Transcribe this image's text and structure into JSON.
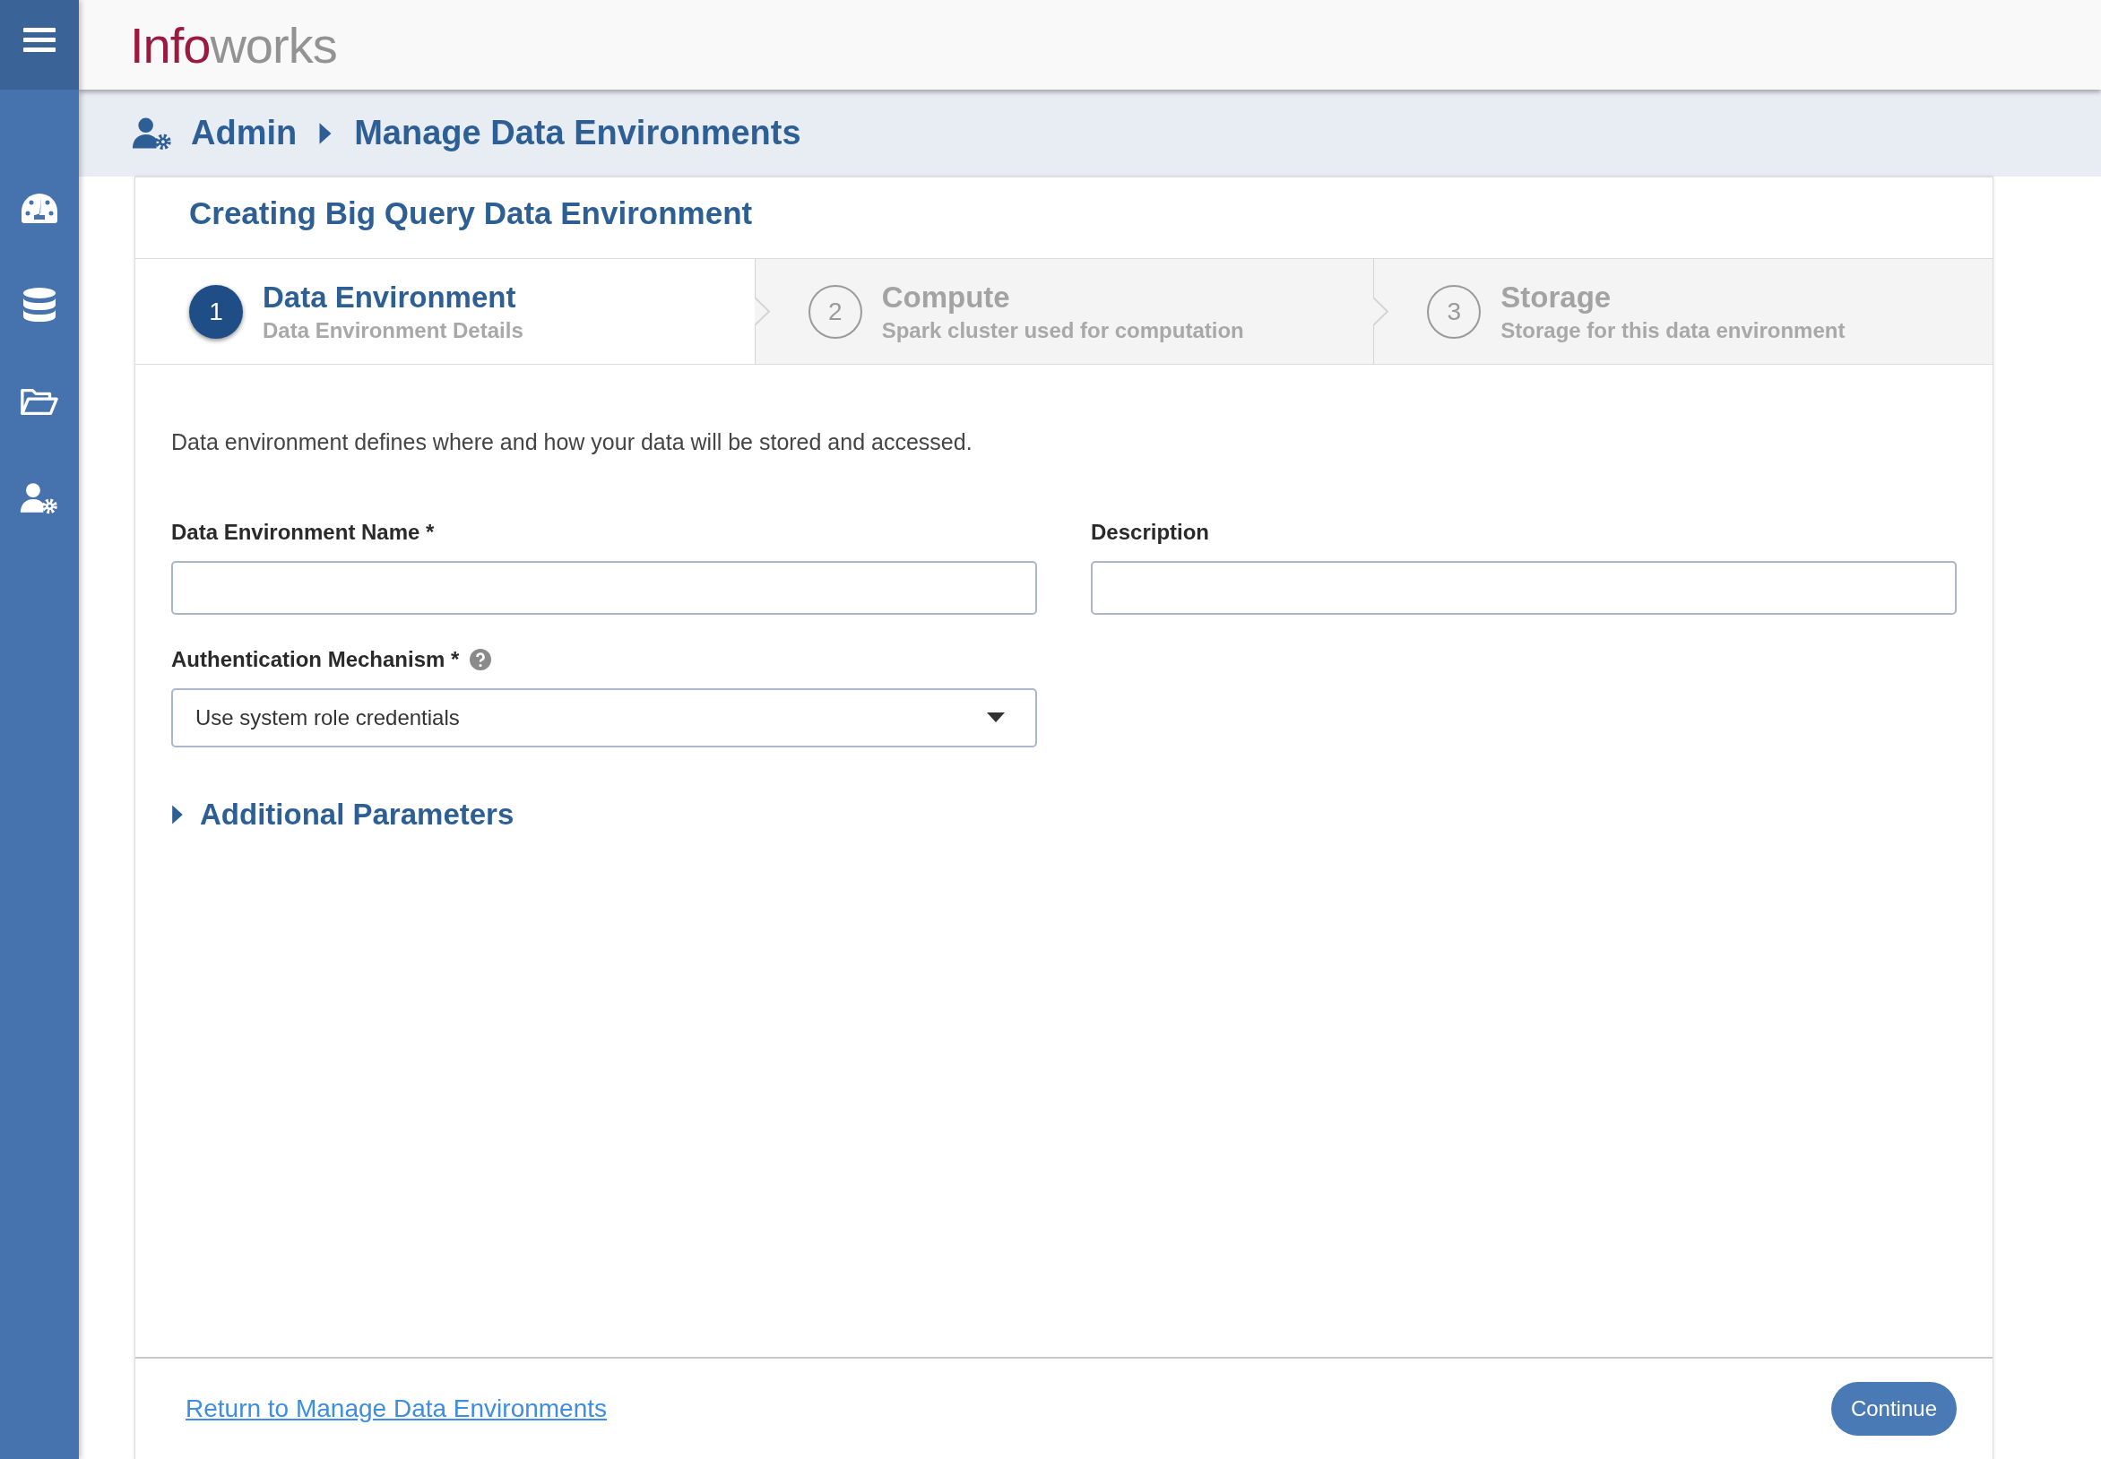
{
  "logo": {
    "text_primary": "Info",
    "text_secondary": "works"
  },
  "sidebar": {
    "items": [
      {
        "kind": "gauge"
      },
      {
        "kind": "database"
      },
      {
        "kind": "folder"
      },
      {
        "kind": "admin"
      }
    ]
  },
  "breadcrumb": {
    "items": [
      "Admin",
      "Manage Data Environments"
    ]
  },
  "card": {
    "title": "Creating Big Query Data Environment"
  },
  "steps": [
    {
      "number": "1",
      "title": "Data Environment",
      "subtitle": "Data Environment Details",
      "selected": true
    },
    {
      "number": "2",
      "title": "Compute",
      "subtitle": "Spark cluster used for computation",
      "selected": false
    },
    {
      "number": "3",
      "title": "Storage",
      "subtitle": "Storage for this data environment",
      "selected": false
    }
  ],
  "intro": "Data environment defines where and how your data will be stored and accessed.",
  "fields": {
    "name": {
      "label": "Data Environment Name *"
    },
    "description": {
      "label": "Description"
    },
    "auth": {
      "label": "Authentication Mechanism *",
      "value": "Use system role credentials"
    }
  },
  "additional": {
    "label": "Additional Parameters",
    "expanded": false
  },
  "footer": {
    "link": "Return to Manage Data Environments",
    "button": "Continue"
  }
}
